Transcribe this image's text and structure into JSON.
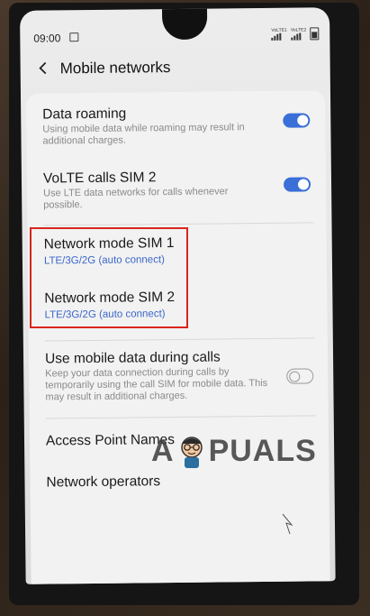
{
  "status_bar": {
    "time": "09:00",
    "sim1_label": "VoLTE1",
    "sim2_label": "VoLTE2",
    "net1": "LTE1",
    "net2": "4G"
  },
  "header": {
    "title": "Mobile networks"
  },
  "settings": [
    {
      "title": "Data roaming",
      "subtitle": "Using mobile data while roaming may result in additional charges.",
      "toggle": "on"
    },
    {
      "title": "VoLTE calls SIM 2",
      "subtitle": "Use LTE data networks for calls whenever possible.",
      "toggle": "on"
    },
    {
      "title": "Network mode SIM 1",
      "value": "LTE/3G/2G (auto connect)"
    },
    {
      "title": "Network mode SIM 2",
      "value": "LTE/3G/2G (auto connect)"
    },
    {
      "title": "Use mobile data during calls",
      "subtitle": "Keep your data connection during calls by temporarily using the call SIM for mobile data. This may result in additional charges.",
      "toggle": "off"
    },
    {
      "title": "Access Point Names"
    },
    {
      "title": "Network operators"
    }
  ],
  "watermark": {
    "text_left": "A",
    "text_right": "PUALS"
  },
  "colors": {
    "accent": "#3a6fd8",
    "highlight": "#d9251d",
    "value_blue": "#3a67c9"
  }
}
